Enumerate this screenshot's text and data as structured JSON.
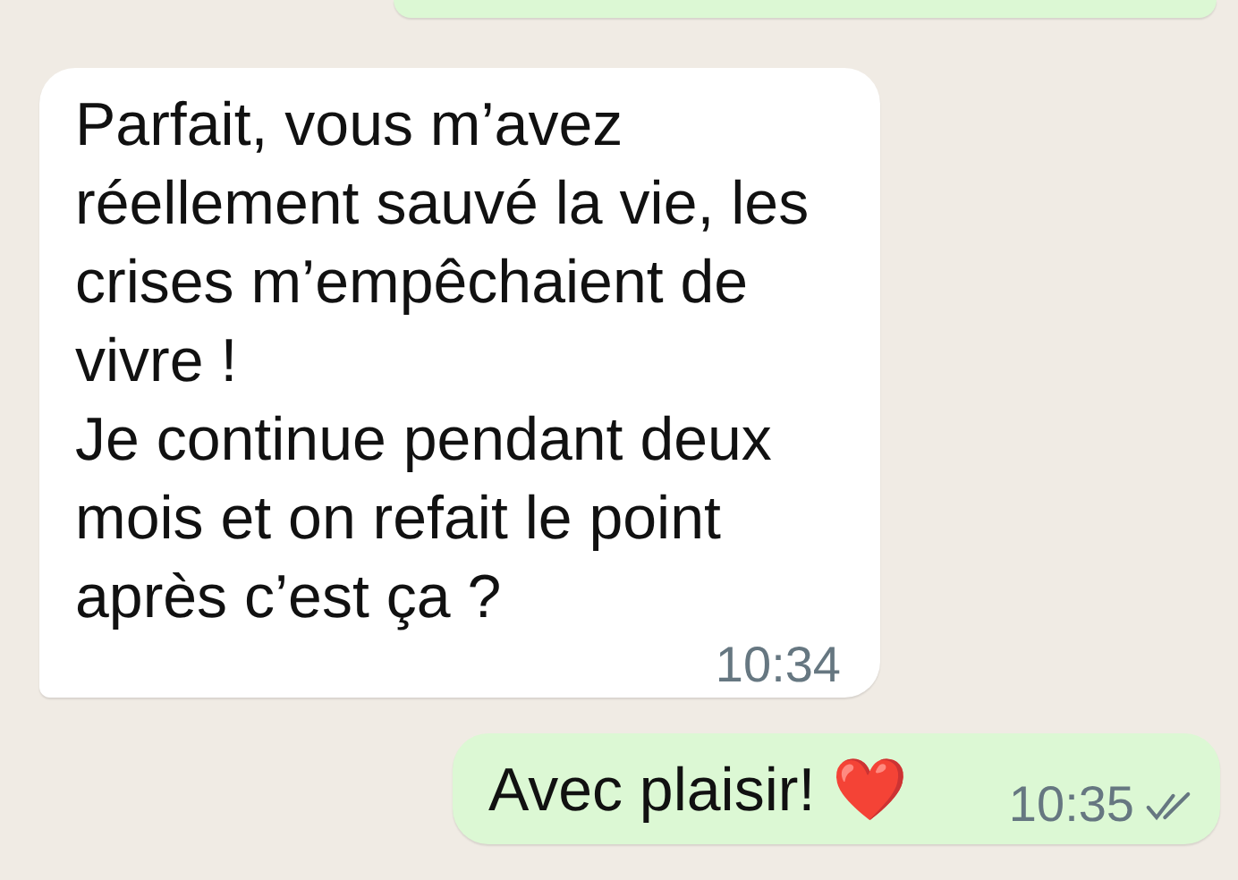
{
  "messages": [
    {
      "kind": "outgoing"
    },
    {
      "kind": "incoming",
      "text": "Parfait, vous m’avez réellement sauvé la vie, les crises m’empêchaient de vivre !\nJe continue pendant deux mois et on refait le point après c’est ça ?",
      "time": "10:34"
    },
    {
      "kind": "outgoing",
      "text": "Avec plaisir! ❤️",
      "time": "10:35",
      "read": false
    }
  ]
}
